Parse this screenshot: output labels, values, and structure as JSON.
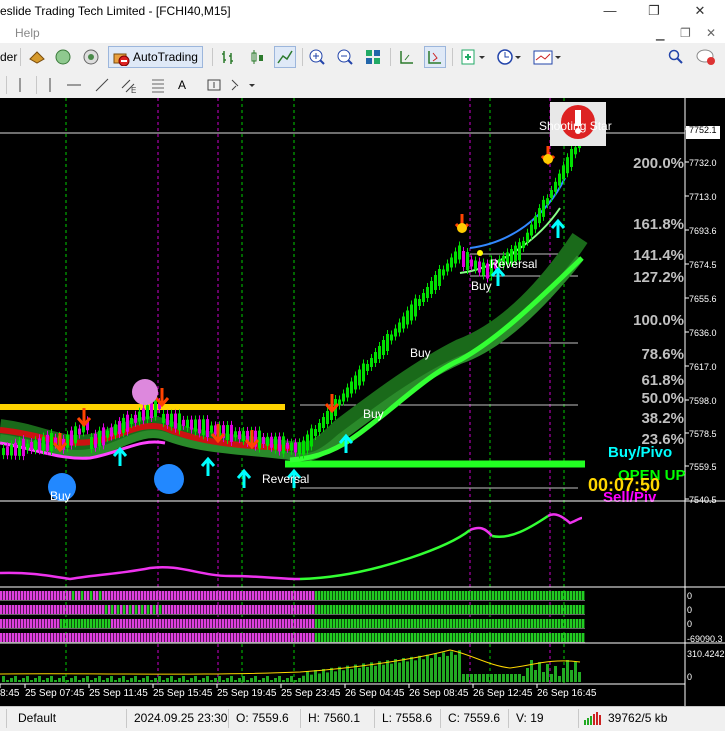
{
  "window": {
    "title": "eslide Trading Tech Limited - [FCHI40,M15]",
    "minimize": "—",
    "restore": "❐",
    "close": "✕"
  },
  "menu": {
    "help": "Help"
  },
  "toolbar": {
    "partial_label": "der",
    "autotrading_label": "AutoTrading"
  },
  "toolbar2": {
    "text_tool": "A"
  },
  "chart": {
    "price_axis": [
      "7752.1",
      "7732.0",
      "7713.0",
      "7693.6",
      "7674.5",
      "7655.6",
      "7636.0",
      "7617.0",
      "7598.0",
      "7578.5",
      "7559.5",
      "7540.5"
    ],
    "fib_labels": [
      "200.0%",
      "161.8%",
      "141.4%",
      "127.2%",
      "100.0%",
      "78.6%",
      "61.8%",
      "50.0%",
      "38.2%",
      "23.6%"
    ],
    "annotations": {
      "shooting_star": "Shooting Star",
      "reversal_top": "Reversal",
      "buy_top": "Buy",
      "buy_mid": "Buy",
      "buy_low": "Buy",
      "reversal_bottom": "Reversal",
      "buy_bottom": "Buy"
    },
    "right_panel": {
      "buy_pivot": "Buy/Pivo",
      "open_up": "OPEN UP",
      "timer": "00:07:50",
      "sell_pivot": "Sell/Piv"
    },
    "subwindow_axis": [
      "0",
      "0",
      "0",
      "-69090.3"
    ],
    "volume_axis": [
      "310.4242",
      "0"
    ],
    "time_axis": [
      "8:45",
      "25 Sep 07:45",
      "25 Sep 11:45",
      "25 Sep 15:45",
      "25 Sep 19:45",
      "25 Sep 23:45",
      "26 Sep 04:45",
      "26 Sep 08:45",
      "26 Sep 12:45",
      "26 Sep 16:45"
    ],
    "colors": {
      "bull": "#00e000",
      "bear": "#e000e0",
      "ribbon": "#00ff00",
      "resistance": "#ffd400",
      "fib": "#c0c0c0",
      "timer": "#ffd700",
      "buy_pivot": "#00ffff",
      "open_up": "#00ff00",
      "sell_pivot": "#ff00ff"
    }
  },
  "status": {
    "profile": "Default",
    "datetime": "2024.09.25 23:30",
    "open": "O: 7559.6",
    "high": "H: 7560.1",
    "low": "L: 7558.6",
    "close": "C: 7559.6",
    "volume": "V: 19",
    "traffic": "39762/5 kb"
  }
}
